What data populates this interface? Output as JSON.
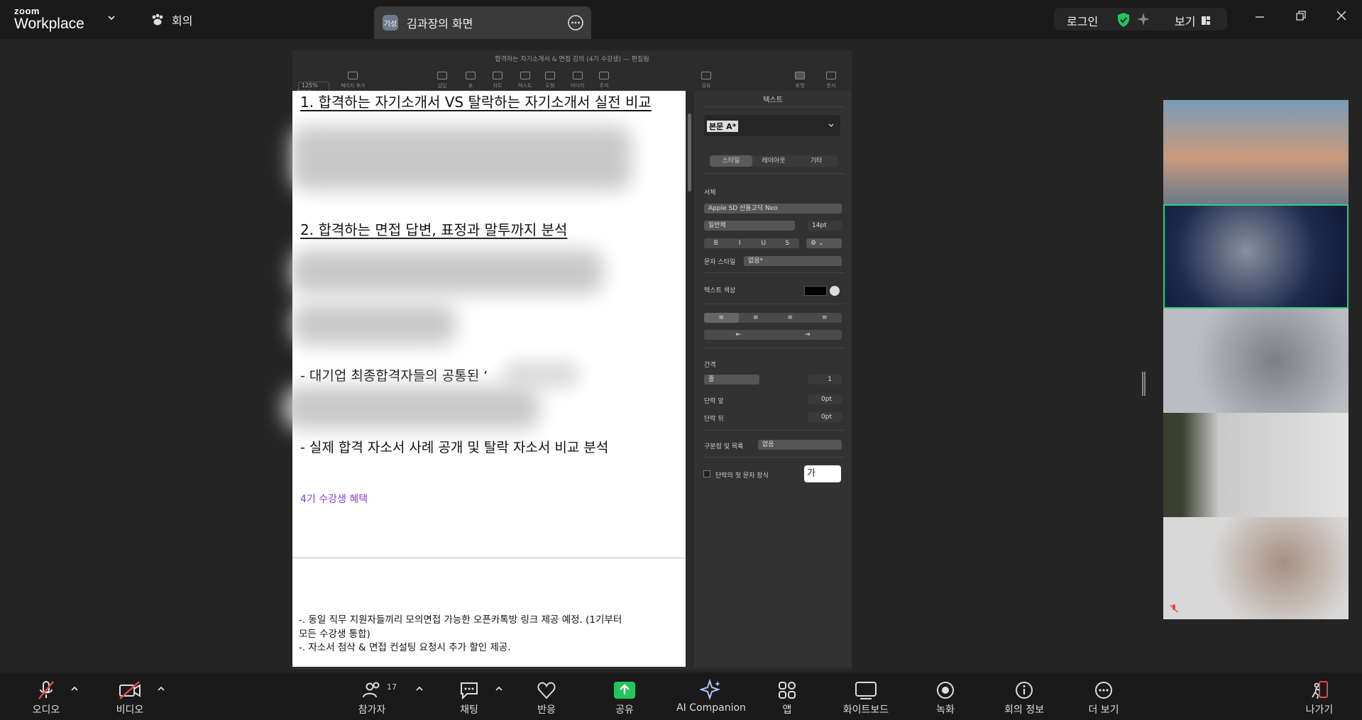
{
  "topbar": {
    "brand_top": "zoom",
    "brand_bottom": "Workplace",
    "meeting_label": "회의",
    "share_badge": "기성",
    "share_title": "김과장의 화면",
    "login_label": "로그인",
    "view_label": "보기"
  },
  "document": {
    "window_title": "합격하는 자기소개서 & 면접 강의 (4기 수강생) — 편집됨",
    "zoom": "125%",
    "toolbar": [
      "확대/축소",
      "페이지 추가",
      "삽입",
      "표",
      "차트",
      "텍스트",
      "도형",
      "미디어",
      "주석",
      "공유",
      "포맷",
      "문서"
    ],
    "heading1": "1. 합격하는 자기소개서 VS 탈락하는 자기소개서 실전 비교",
    "heading2": "2. 합격하는 면접 답변, 표정과 말투까지 분석",
    "bullet1": "-  대기업 최종합격자들의 공통된 ‘",
    "bullet2": "-  실제 합격 자소서 사례 공개 및 탈락 자소서 비교 분석",
    "benefit_title": "4기 수강생 혜택",
    "footer_line1": "-. 동일 직무 지원자들끼리 모의면접 가능한 오픈카톡방 링크 제공 예정. (1기부터",
    "footer_line2": "모든 수강생 통합)",
    "footer_line3": "-. 자소서 첨삭 & 면접 컨설팅 요청시 추가 할인 제공."
  },
  "format_panel": {
    "title": "텍스트",
    "paragraph_style": "본문 A*",
    "tabs": [
      "스타일",
      "레이아웃",
      "기타"
    ],
    "font_label": "서체",
    "font_name": "Apple SD 산돌고딕 Neo",
    "font_weight": "일반체",
    "font_size": "14pt",
    "style_buttons": [
      "B",
      "I",
      "U",
      "S"
    ],
    "char_style_label": "문자 스타일",
    "char_style_value": "없음*",
    "text_color_label": "텍스트 색상",
    "spacing_label": "간격",
    "line_label": "줄",
    "line_value": "1",
    "before_label": "단락 앞",
    "before_value": "0pt",
    "after_label": "단락 뒤",
    "after_value": "0pt",
    "bullets_label": "구분점 및 목록",
    "bullets_value": "없음",
    "dropcap_label": "단락의 첫 문자 장식",
    "dropcap_value": "가"
  },
  "toolbar": {
    "audio": "오디오",
    "video": "비디오",
    "participants": "참가자",
    "participants_count": "17",
    "chat": "채팅",
    "reactions": "반응",
    "share": "공유",
    "ai": "AI Companion",
    "apps": "앱",
    "whiteboard": "화이트보드",
    "record": "녹화",
    "info": "회의 정보",
    "more": "더 보기",
    "leave": "나가기"
  },
  "colors": {
    "share_green": "#22c55e",
    "talking_border": "#2ad17a",
    "leave_red": "#e5484d",
    "benefit_purple": "#8a3ec9"
  }
}
